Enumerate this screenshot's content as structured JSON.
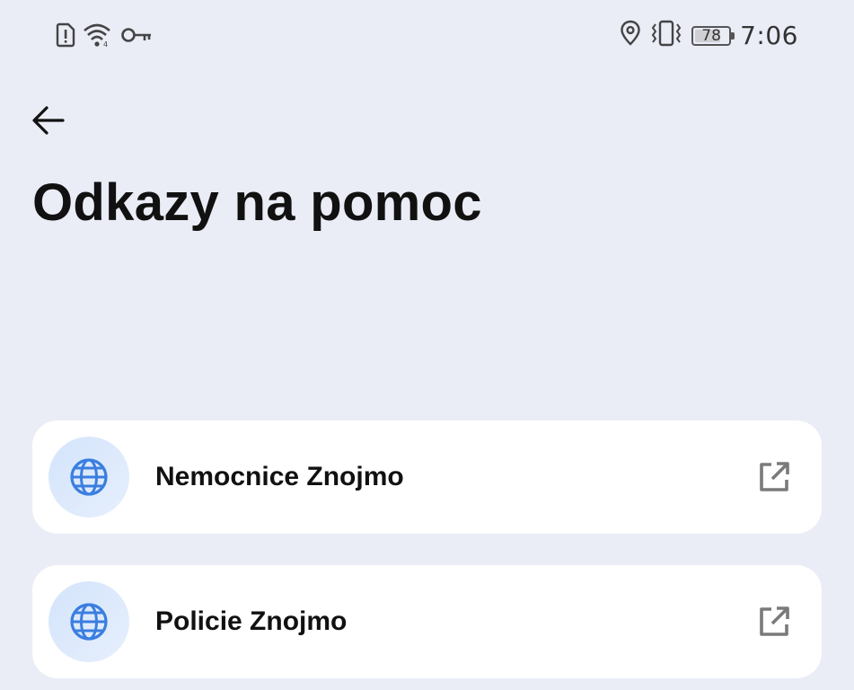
{
  "status_bar": {
    "left_icons": [
      "sim-alert-icon",
      "wifi-icon",
      "vpn-key-icon"
    ],
    "right_icons": [
      "location-icon",
      "vibrate-icon"
    ],
    "battery_level": "78",
    "time": "7:06"
  },
  "header": {
    "back_icon": "arrow-left-icon",
    "title": "Odkazy na pomoc"
  },
  "links": [
    {
      "label": "Nemocnice Znojmo",
      "icon": "globe-icon",
      "action_icon": "open-external-icon"
    },
    {
      "label": "Policie Znojmo",
      "icon": "globe-icon",
      "action_icon": "open-external-icon"
    }
  ],
  "colors": {
    "background": "#eaecf6",
    "card": "#ffffff",
    "globe": "#3a7ee0",
    "icon_gray": "#7a7a7a"
  }
}
